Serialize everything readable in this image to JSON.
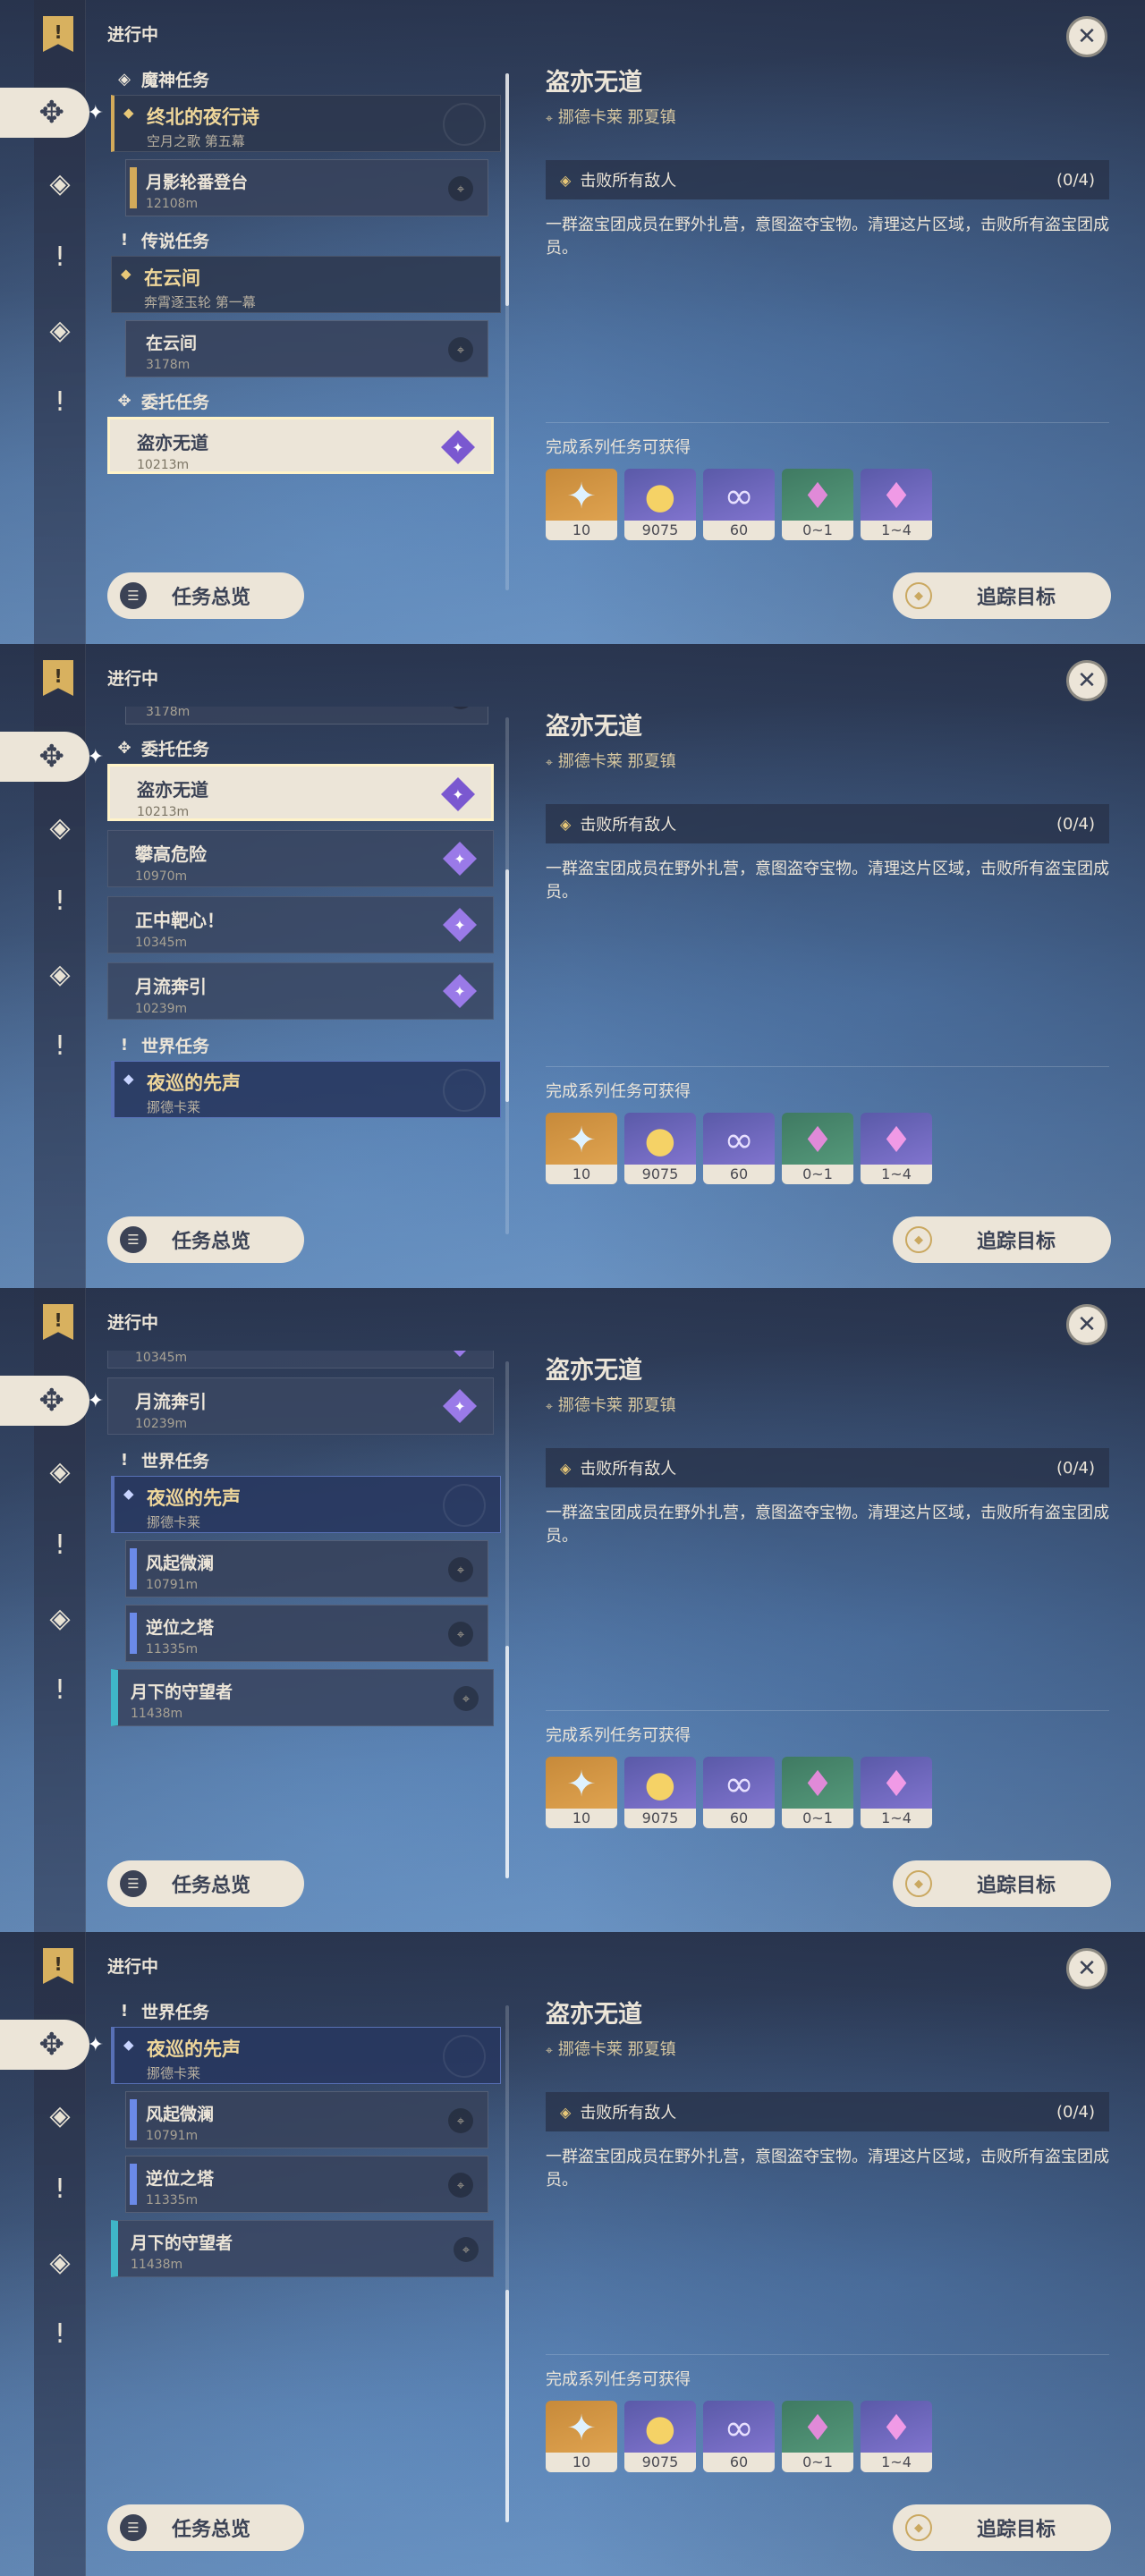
{
  "header": {
    "status": "进行中"
  },
  "rail": {
    "bookmark_glyph": "!",
    "active_glyph": "✥",
    "sparkle": "✦",
    "glyphs": [
      "✥",
      "!",
      "◈",
      "!"
    ]
  },
  "categories": {
    "archon": "魔神任务",
    "story": "传说任务",
    "commission": "委托任务",
    "world": "世界任务"
  },
  "archon_quest": {
    "title": "终北的夜行诗",
    "subtitle": "空月之歌 第五幕"
  },
  "archon_step": {
    "title": "月影轮番登台",
    "distance": "12108m"
  },
  "story_quest": {
    "title": "在云间",
    "subtitle": "奔霄逐玉轮 第一幕"
  },
  "story_step": {
    "title": "在云间",
    "distance": "3178m"
  },
  "commissions": [
    {
      "title": "盗亦无道",
      "distance": "10213m"
    },
    {
      "title": "攀高危险",
      "distance": "10970m"
    },
    {
      "title": "正中靶心！",
      "distance": "10345m"
    },
    {
      "title": "月流奔引",
      "distance": "10239m"
    }
  ],
  "world_quest": {
    "title": "夜巡的先声",
    "subtitle": "挪德卡莱"
  },
  "world_steps": [
    {
      "title": "风起微澜",
      "distance": "10791m"
    },
    {
      "title": "逆位之塔",
      "distance": "11335m"
    }
  ],
  "other_quest": {
    "title": "月下的守望者",
    "distance": "11438m"
  },
  "detail": {
    "title": "盗亦无道",
    "location": "挪德卡莱 那夏镇",
    "objective": "击败所有敌人",
    "objective_count": "(0/4)",
    "description": "一群盗宝团成员在野外扎营，意图盗夺宝物。清理这片区域，击败所有盗宝团成员。",
    "rewards_label": "完成系列任务可获得",
    "rewards": [
      {
        "icon": "primogem-icon",
        "count": "10"
      },
      {
        "icon": "mora-icon",
        "count": "9075"
      },
      {
        "icon": "companionship-exp-icon",
        "count": "60"
      },
      {
        "icon": "crystal-icon",
        "count": "0~1"
      },
      {
        "icon": "crystal-cluster-icon",
        "count": "1~4"
      }
    ]
  },
  "buttons": {
    "overview": "任务总览",
    "track": "追踪目标",
    "close": "✕"
  },
  "scroll_progress": [
    0.0,
    0.35,
    0.7,
    1.0
  ]
}
